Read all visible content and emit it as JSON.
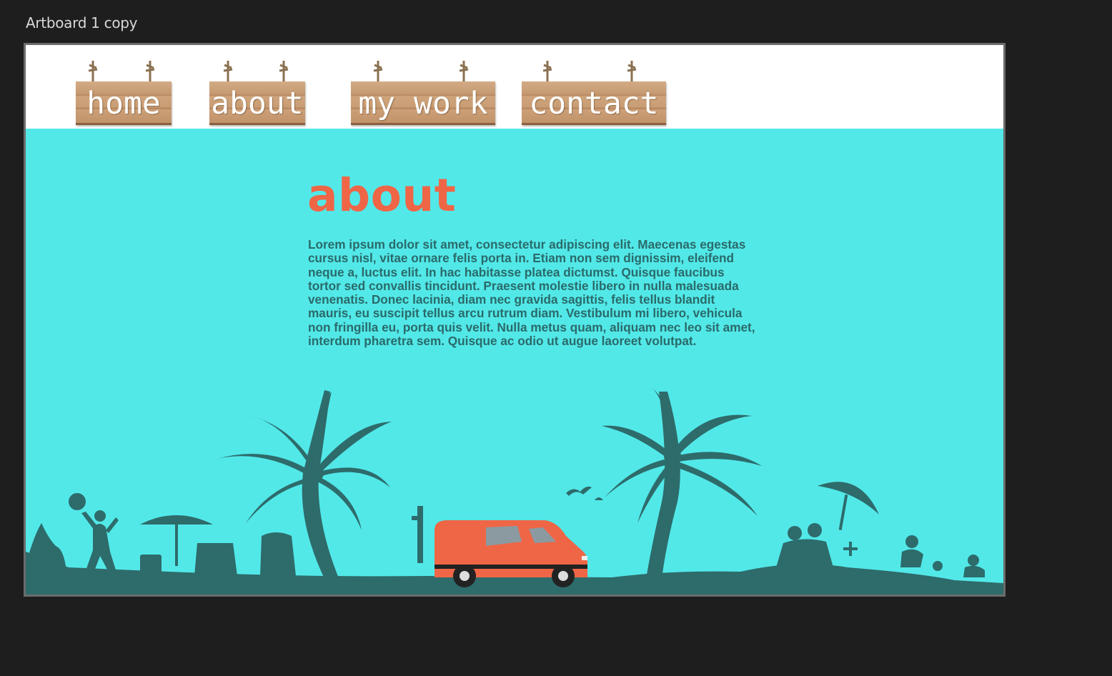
{
  "artboard": {
    "title": "Artboard 1 copy"
  },
  "nav": {
    "items": [
      {
        "label": "home"
      },
      {
        "label": "about"
      },
      {
        "label": "my work"
      },
      {
        "label": "contact"
      }
    ]
  },
  "main": {
    "heading": "about",
    "body": "Lorem ipsum dolor sit amet, consectetur adipiscing elit. Maecenas egestas cursus nisl, vitae ornare felis porta in. Etiam non sem dignissim, eleifend neque a, luctus elit. In hac habitasse platea dictumst. Quisque faucibus tortor sed convallis tincidunt. Praesent molestie libero in nulla malesuada venenatis. Donec lacinia, diam nec gravida sagittis, felis tellus blandit mauris, eu suscipit tellus arcu rutrum diam. Vestibulum mi libero, vehicula non fringilla eu, porta quis velit. Nulla metus quam, aliquam nec leo sit amet, interdum pharetra sem. Quisque ac odio ut augue laoreet volutpat."
  },
  "colors": {
    "background": "#1e1e1e",
    "sky": "#52e8e8",
    "heading": "#ef6647",
    "text": "#2b6a6a",
    "silhouette": "#2e6b6b",
    "van": "#ef6647"
  },
  "icons": [
    "wooden-sign-icon",
    "palm-tree-icon",
    "van-icon",
    "beach-umbrella-icon",
    "beach-people-icon"
  ]
}
